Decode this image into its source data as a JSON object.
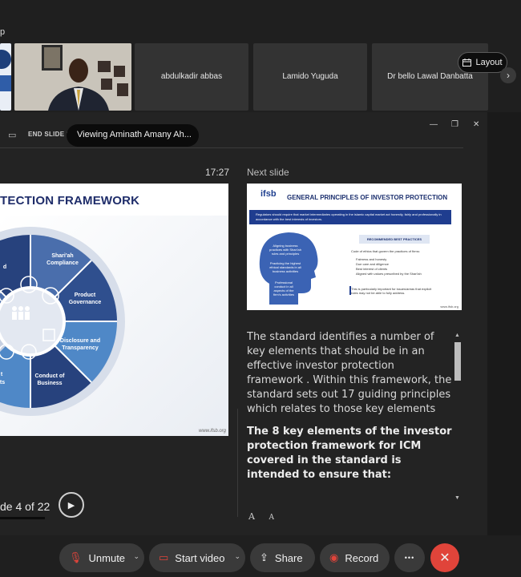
{
  "titlebar": {
    "app_fragment": "p"
  },
  "participants": {
    "tile_c": "abdulkadir abbas",
    "tile_d": "Lamido Yuguda",
    "tile_e": "Dr bello Lawal Danbatta",
    "layout_label": "Layout"
  },
  "share": {
    "end_slide_label": "END SLIDE SI",
    "viewing_label": "Viewing Aminath Amany Ah...",
    "time": "17:27",
    "next_slide_label": "Next slide",
    "slide_counter": "de 4 of 22"
  },
  "slide": {
    "heading": "TECTION FRAMEWORK",
    "segments": [
      "Shari'ah Compliance",
      "Product Governance",
      "Disclosure and Transparency",
      "Conduct of Business"
    ],
    "partial_labels": [
      "d",
      "t",
      "ts"
    ],
    "footer_url": "www.ifsb.org"
  },
  "next_slide": {
    "logo": "ifsb",
    "title": "GENERAL PRINCIPLES OF INVESTOR PROTECTION",
    "band": "Regulators should require that market intermediaries operating in the islamic capital market act honestly, fairly and professionally in accordance with the best interests of investors.",
    "recommended": "RECOMMENDED BEST PRACTICES",
    "code_line": "Code of ethics that govern the practices of firms:",
    "list": [
      "Fairness and honesty",
      "Due care and diligence",
      "Best interest of clients",
      "Aligned with values prescribed by the Shari'ah"
    ],
    "note": "This is particularly important for issues/areas that explicit rules may not be able to fully address.",
    "head_lines": [
      "Aligning business practices with Shari'ah rules and principles",
      "Practicing the highest ethical standards in all business activities",
      "Professional conduct in all aspects of the firm's activities"
    ],
    "url": "www.ifsb.org"
  },
  "notes": {
    "para1": "The standard identifies a number of key elements that should be in an effective investor protection framework . Within this framework, the standard sets out 17 guiding principles which relates to those key elements",
    "para2": "The 8 key elements of the investor protection framework for ICM covered in the standard is intended to ensure that:",
    "font_larger": "A",
    "font_smaller": "A"
  },
  "toolbar": {
    "unmute": "Unmute",
    "start_video": "Start video",
    "share": "Share",
    "record": "Record",
    "more": "•••"
  },
  "colors": {
    "accent_red": "#e0443a",
    "slide_navy": "#1f2d6a",
    "segment_blue": "#3f64a6"
  }
}
